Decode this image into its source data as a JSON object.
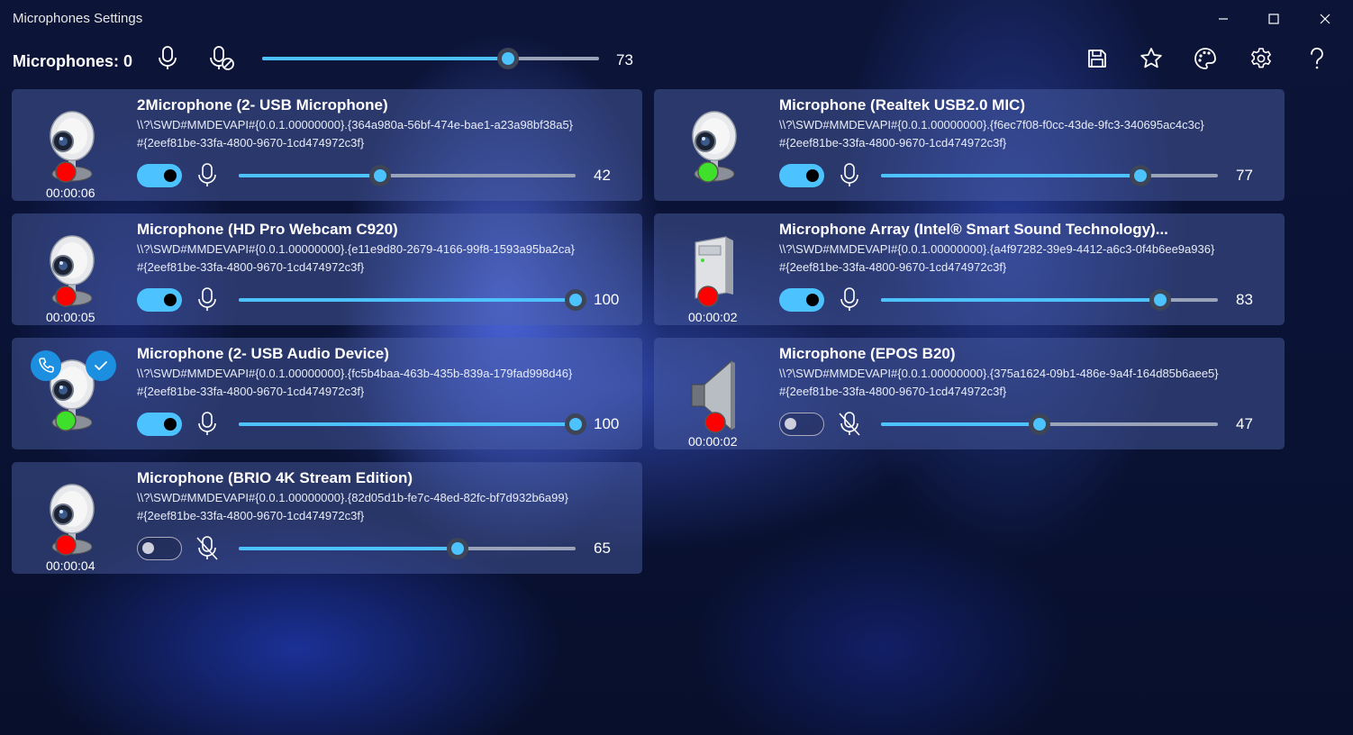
{
  "window": {
    "title": "Microphones Settings",
    "minimize_icon": "minimize-icon",
    "maximize_icon": "maximize-icon",
    "close_icon": "close-icon"
  },
  "toolbar": {
    "count_label": "Microphones: 0",
    "master_volume": 73,
    "master_volume_label": "73",
    "icons": [
      "microphone-icon",
      "microphone-off-icon",
      "save-icon",
      "star-icon",
      "palette-icon",
      "gear-icon",
      "help-icon"
    ]
  },
  "colors": {
    "accent": "#4cc2ff",
    "status_red": "#ff0000",
    "status_green": "#3ee02c",
    "badge_blue": "#1d8fe0"
  },
  "devices": [
    {
      "name": "2Microphone (2- USB Microphone)",
      "id_line1": "\\\\?\\SWD#MMDEVAPI#{0.0.1.00000000}.{364a980a-56bf-474e-bae1-a23a98bf38a5}",
      "id_line2": "#{2eef81be-33fa-4800-9670-1cd474972c3f}",
      "enabled": true,
      "muted": false,
      "volume": 42,
      "volume_label": "42",
      "timer": "00:00:06",
      "status": "red",
      "device_icon": "webcam-icon"
    },
    {
      "name": "Microphone (Realtek USB2.0 MIC)",
      "id_line1": "\\\\?\\SWD#MMDEVAPI#{0.0.1.00000000}.{f6ec7f08-f0cc-43de-9fc3-340695ac4c3c}",
      "id_line2": "#{2eef81be-33fa-4800-9670-1cd474972c3f}",
      "enabled": true,
      "muted": false,
      "volume": 77,
      "volume_label": "77",
      "timer": "",
      "status": "green",
      "device_icon": "webcam-icon"
    },
    {
      "name": "Microphone (HD Pro Webcam C920)",
      "id_line1": "\\\\?\\SWD#MMDEVAPI#{0.0.1.00000000}.{e11e9d80-2679-4166-99f8-1593a95ba2ca}",
      "id_line2": "#{2eef81be-33fa-4800-9670-1cd474972c3f}",
      "enabled": true,
      "muted": false,
      "volume": 100,
      "volume_label": "100",
      "timer": "00:00:05",
      "status": "red",
      "device_icon": "webcam-icon"
    },
    {
      "name": "Microphone Array (Intel® Smart Sound Technology)...",
      "id_line1": "\\\\?\\SWD#MMDEVAPI#{0.0.1.00000000}.{a4f97282-39e9-4412-a6c3-0f4b6ee9a936}",
      "id_line2": "#{2eef81be-33fa-4800-9670-1cd474972c3f}",
      "enabled": true,
      "muted": false,
      "volume": 83,
      "volume_label": "83",
      "timer": "00:00:02",
      "status": "red",
      "device_icon": "computer-tower-icon"
    },
    {
      "name": "Microphone (2- USB Audio Device)",
      "id_line1": "\\\\?\\SWD#MMDEVAPI#{0.0.1.00000000}.{fc5b4baa-463b-435b-839a-179fad998d46}",
      "id_line2": "#{2eef81be-33fa-4800-9670-1cd474972c3f}",
      "enabled": true,
      "muted": false,
      "volume": 100,
      "volume_label": "100",
      "timer": "",
      "status": "green",
      "device_icon": "webcam-icon",
      "badges": [
        "phone-icon",
        "checkmark-icon"
      ]
    },
    {
      "name": "Microphone (EPOS B20)",
      "id_line1": "\\\\?\\SWD#MMDEVAPI#{0.0.1.00000000}.{375a1624-09b1-486e-9a4f-164d85b6aee5}",
      "id_line2": "#{2eef81be-33fa-4800-9670-1cd474972c3f}",
      "enabled": false,
      "muted": true,
      "volume": 47,
      "volume_label": "47",
      "timer": "00:00:02",
      "status": "red",
      "device_icon": "speaker-icon"
    },
    {
      "name": "Microphone (BRIO 4K Stream Edition)",
      "id_line1": "\\\\?\\SWD#MMDEVAPI#{0.0.1.00000000}.{82d05d1b-fe7c-48ed-82fc-bf7d932b6a99}",
      "id_line2": "#{2eef81be-33fa-4800-9670-1cd474972c3f}",
      "enabled": false,
      "muted": true,
      "volume": 65,
      "volume_label": "65",
      "timer": "00:00:04",
      "status": "red",
      "device_icon": "webcam-icon"
    }
  ]
}
